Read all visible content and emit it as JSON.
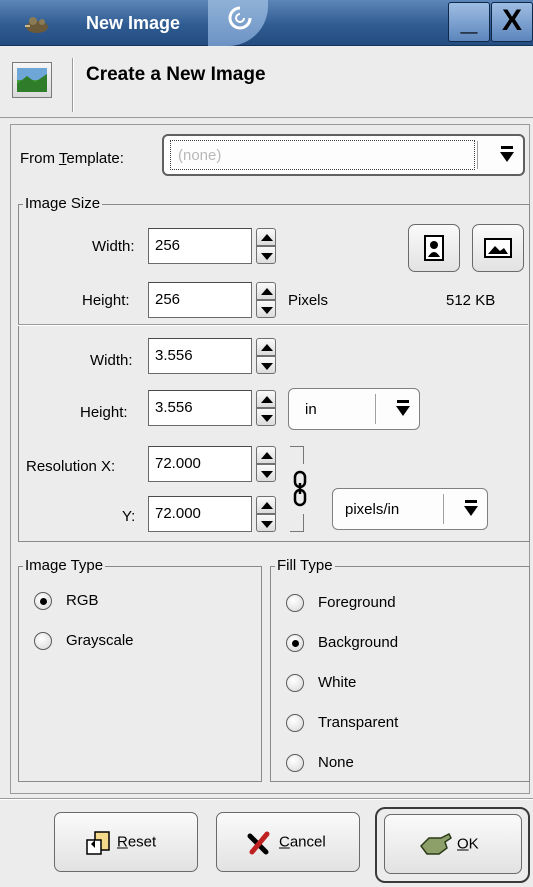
{
  "window": {
    "title": "New Image",
    "minimize_label": "_",
    "close_label": "X"
  },
  "header": {
    "title": "Create a New Image"
  },
  "template": {
    "label_prefix": "From ",
    "label_mnemonic": "T",
    "label_suffix": "emplate:",
    "value": "(none)"
  },
  "image_size": {
    "title": "Image Size",
    "pixel_width_label": "Width:",
    "pixel_width": "256",
    "pixel_height_label": "Height:",
    "pixel_height": "256",
    "pixel_unit": "Pixels",
    "memory_size": "512 KB",
    "width_label": "Width:",
    "width": "3.556",
    "height_label": "Height:",
    "height": "3.556",
    "unit": "in",
    "resolution_x_label": "Resolution X:",
    "resolution_x": "72.000",
    "resolution_y_label": "Y:",
    "resolution_y": "72.000",
    "resolution_unit": "pixels/in"
  },
  "image_type": {
    "title": "Image Type",
    "options": [
      {
        "label": "RGB",
        "selected": true
      },
      {
        "label": "Grayscale",
        "selected": false
      }
    ]
  },
  "fill_type": {
    "title": "Fill Type",
    "options": [
      {
        "label": "Foreground",
        "selected": false
      },
      {
        "label": "Background",
        "selected": true
      },
      {
        "label": "White",
        "selected": false
      },
      {
        "label": "Transparent",
        "selected": false
      },
      {
        "label": "None",
        "selected": false
      }
    ]
  },
  "buttons": {
    "reset_mnemonic": "R",
    "reset_rest": "eset",
    "cancel_mnemonic": "C",
    "cancel_rest": "ancel",
    "ok_mnemonic": "O",
    "ok_rest": "K"
  },
  "colors": {
    "titlebar": "#2f5c93",
    "background": "#ececec"
  }
}
